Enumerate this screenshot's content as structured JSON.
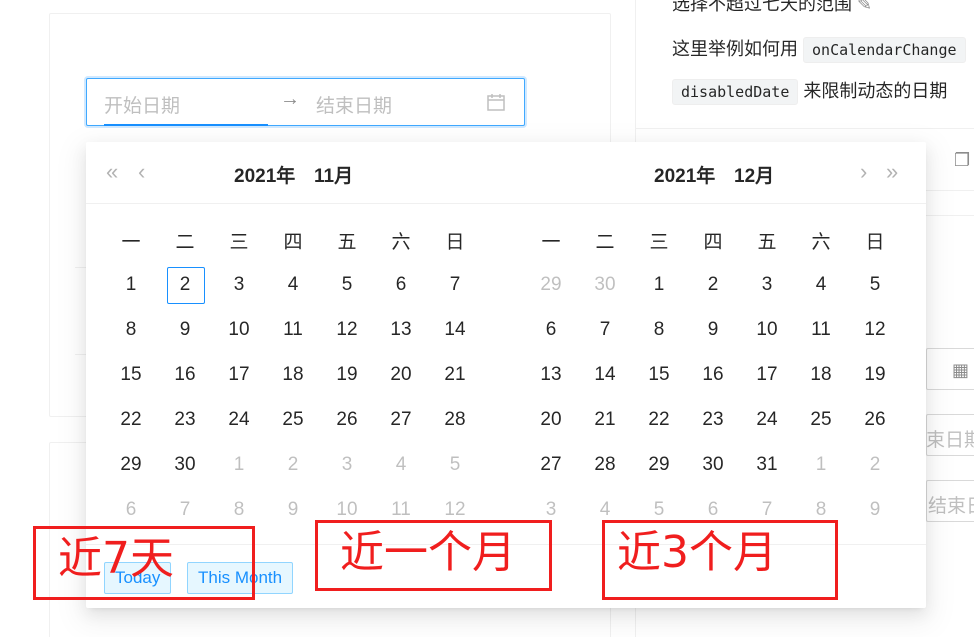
{
  "doc": {
    "line1": "选择不超过七天的范围",
    "line2_prefix": "这里举例如何用",
    "code1": "onCalendarChange",
    "code2": "disabledDate",
    "line3_suffix": "来限制动态的日期",
    "right_field_1": "束日期",
    "right_field_2": "结束日"
  },
  "range_picker": {
    "start_placeholder": "开始日期",
    "end_placeholder": "结束日期",
    "arrow": "→"
  },
  "calendar": {
    "left": {
      "year": "2021年",
      "month": "11月"
    },
    "right": {
      "year": "2021年",
      "month": "12月"
    },
    "nav": {
      "super_prev": "«",
      "prev": "‹",
      "next": "›",
      "super_next": "»"
    },
    "weekdays": [
      "一",
      "二",
      "三",
      "四",
      "五",
      "六",
      "日"
    ],
    "left_days": [
      [
        "1",
        "2",
        "3",
        "4",
        "5",
        "6",
        "7"
      ],
      [
        "8",
        "9",
        "10",
        "11",
        "12",
        "13",
        "14"
      ],
      [
        "15",
        "16",
        "17",
        "18",
        "19",
        "20",
        "21"
      ],
      [
        "22",
        "23",
        "24",
        "25",
        "26",
        "27",
        "28"
      ],
      [
        "29",
        "30",
        "1",
        "2",
        "3",
        "4",
        "5"
      ],
      [
        "6",
        "7",
        "8",
        "9",
        "10",
        "11",
        "12"
      ]
    ],
    "left_out": [
      [
        0,
        0,
        0,
        0,
        0,
        0,
        0
      ],
      [
        0,
        0,
        0,
        0,
        0,
        0,
        0
      ],
      [
        0,
        0,
        0,
        0,
        0,
        0,
        0
      ],
      [
        0,
        0,
        0,
        0,
        0,
        0,
        0
      ],
      [
        0,
        0,
        1,
        1,
        1,
        1,
        1
      ],
      [
        1,
        1,
        1,
        1,
        1,
        1,
        1
      ]
    ],
    "right_days": [
      [
        "29",
        "30",
        "1",
        "2",
        "3",
        "4",
        "5"
      ],
      [
        "6",
        "7",
        "8",
        "9",
        "10",
        "11",
        "12"
      ],
      [
        "13",
        "14",
        "15",
        "16",
        "17",
        "18",
        "19"
      ],
      [
        "20",
        "21",
        "22",
        "23",
        "24",
        "25",
        "26"
      ],
      [
        "27",
        "28",
        "29",
        "30",
        "31",
        "1",
        "2"
      ],
      [
        "3",
        "4",
        "5",
        "6",
        "7",
        "8",
        "9"
      ]
    ],
    "right_out": [
      [
        1,
        1,
        0,
        0,
        0,
        0,
        0
      ],
      [
        0,
        0,
        0,
        0,
        0,
        0,
        0
      ],
      [
        0,
        0,
        0,
        0,
        0,
        0,
        0
      ],
      [
        0,
        0,
        0,
        0,
        0,
        0,
        0
      ],
      [
        0,
        0,
        0,
        0,
        0,
        1,
        1
      ],
      [
        1,
        1,
        1,
        1,
        1,
        1,
        1
      ]
    ],
    "today": "2"
  },
  "presets": {
    "today": "Today",
    "this_month": "This Month"
  },
  "annotations": {
    "a1": "近7天",
    "a2": "近一个月",
    "a3": "近3个月"
  },
  "colors": {
    "primary": "#1890ff",
    "annotation": "#f01e1e"
  }
}
